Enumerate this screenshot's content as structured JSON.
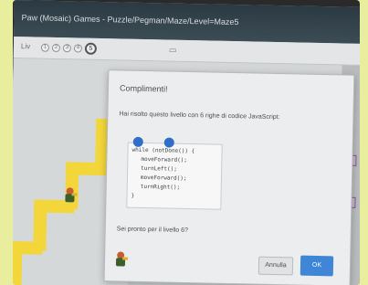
{
  "window": {
    "title": "Paw (Mosaic) Games - Puzzle/Pegman/Maze/Level=Maze5"
  },
  "toolbar": {
    "level_label": "Liv",
    "levels": [
      "1",
      "2",
      "3",
      "4",
      "5"
    ],
    "current_level": "5",
    "map_icon": "map-icon"
  },
  "dialog": {
    "title": "Complimenti!",
    "message": "Hai risolto questo livello con 6 righe di codice JavaScript:",
    "code_lines": [
      {
        "text": "while (notDone()) {",
        "indent": false
      },
      {
        "text": "moveForward();",
        "indent": true
      },
      {
        "text": "turnLeft();",
        "indent": true
      },
      {
        "text": "moveForward();",
        "indent": true
      },
      {
        "text": "turnRight();",
        "indent": true
      },
      {
        "text": "}",
        "indent": false
      }
    ],
    "question": "Sei pronto per il livello 6?",
    "cancel_label": "Annulla",
    "ok_label": "OK"
  },
  "colors": {
    "path": "#f2d63a",
    "accent": "#3f86d6",
    "background": "#e9ee9e"
  }
}
